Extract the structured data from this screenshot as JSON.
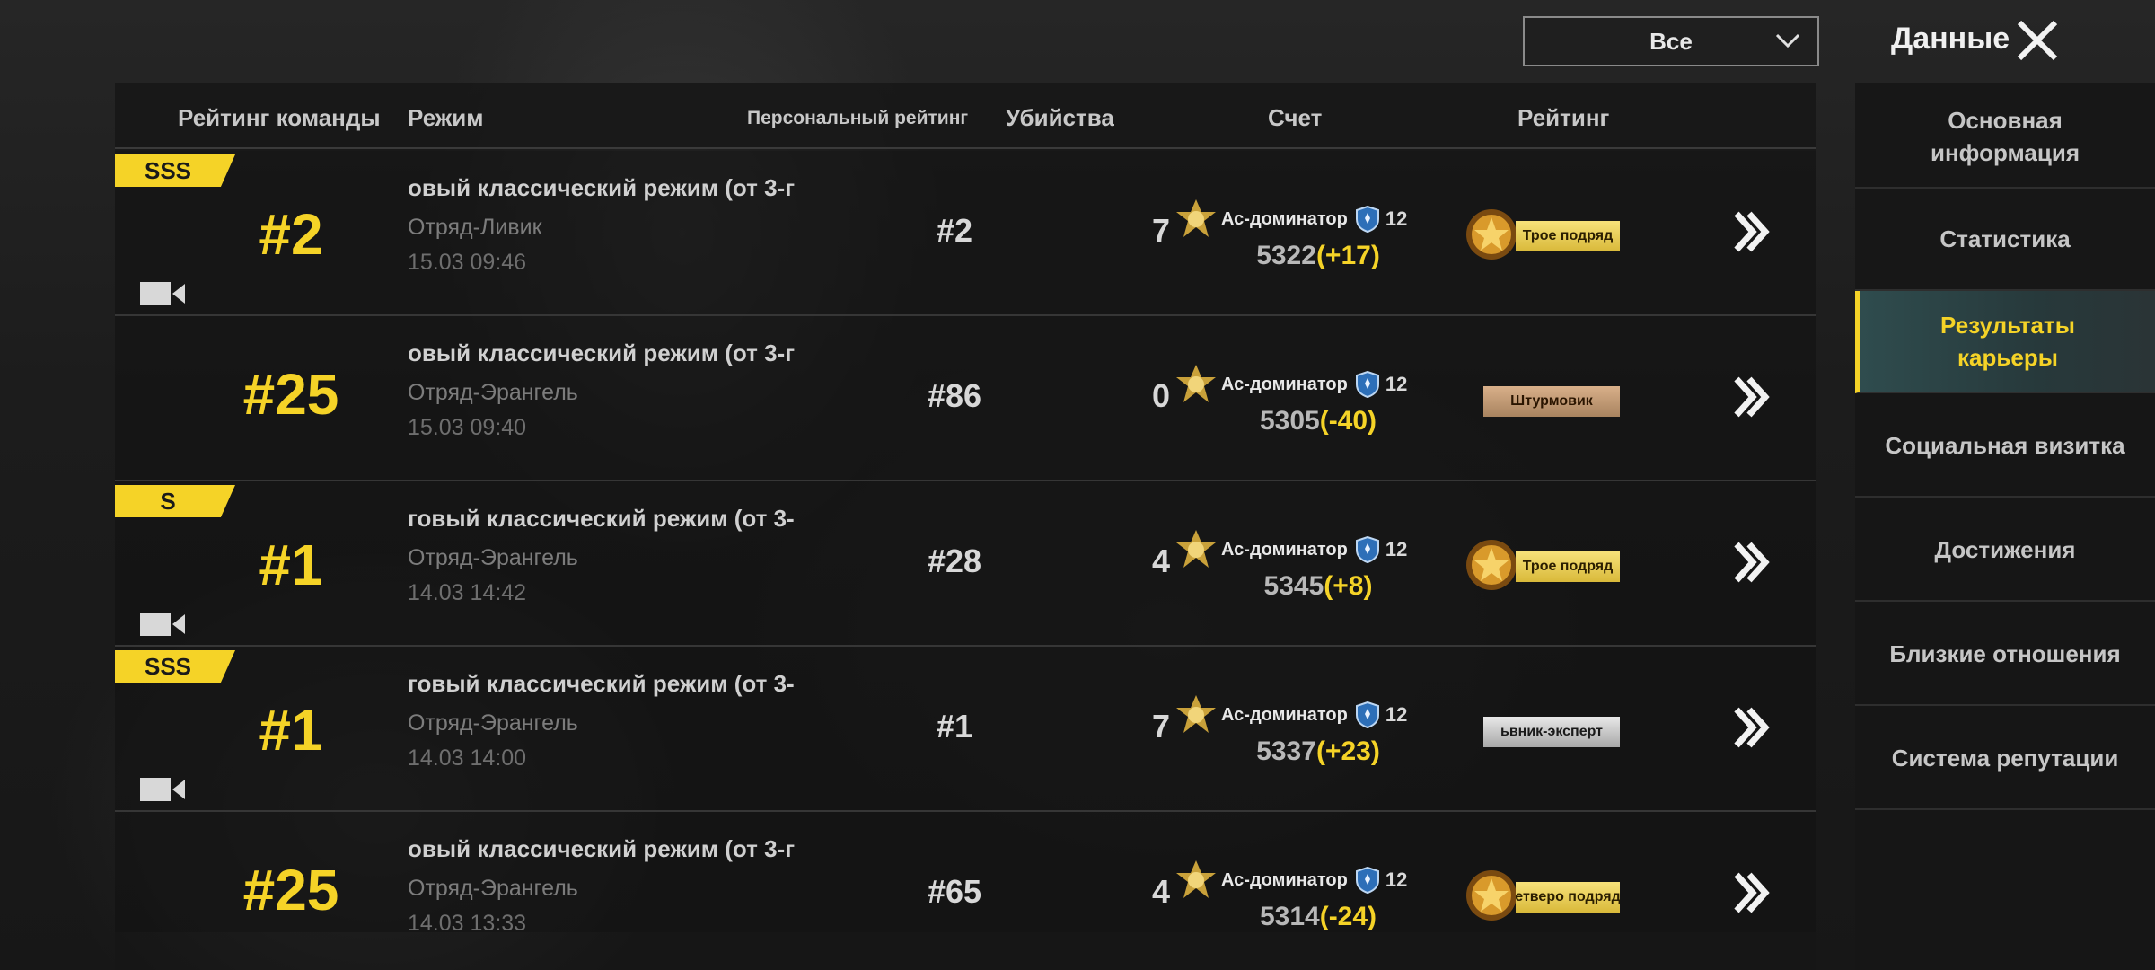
{
  "header": {
    "filter_value": "Все",
    "title": "Данные"
  },
  "columns": {
    "team_rank": "Рейтинг команды",
    "mode": "Режим",
    "personal_rank": "Персональный рейтинг",
    "kills": "Убийства",
    "score": "Счет",
    "rating": "Рейтинг"
  },
  "rows": [
    {
      "grade": "SSS",
      "rank": "#2",
      "mode": "овый классический режим (от 3-г",
      "map": "Отряд-Ливик",
      "time": "15.03 09:46",
      "personal_rank": "#2",
      "kills": "7",
      "tier": "Ас-доминатор",
      "level": "12",
      "score": "5322",
      "delta": "(+17)",
      "achievement": "Трое подряд"
    },
    {
      "grade": "",
      "rank": "#25",
      "mode": "овый классический режим (от 3-г",
      "map": "Отряд-Эрангель",
      "time": "15.03 09:40",
      "personal_rank": "#86",
      "kills": "0",
      "tier": "Ас-доминатор",
      "level": "12",
      "score": "5305",
      "delta": "(-40)",
      "achievement": "Штурмовик"
    },
    {
      "grade": "S",
      "rank": "#1",
      "mode": "говый классический режим (от 3-",
      "map": "Отряд-Эрангель",
      "time": "14.03 14:42",
      "personal_rank": "#28",
      "kills": "4",
      "tier": "Ас-доминатор",
      "level": "12",
      "score": "5345",
      "delta": "(+8)",
      "achievement": "Трое подряд"
    },
    {
      "grade": "SSS",
      "rank": "#1",
      "mode": "говый классический режим (от 3-",
      "map": "Отряд-Эрангель",
      "time": "14.03 14:00",
      "personal_rank": "#1",
      "kills": "7",
      "tier": "Ас-доминатор",
      "level": "12",
      "score": "5337",
      "delta": "(+23)",
      "achievement": "ьвник-эксперт"
    },
    {
      "grade": "",
      "rank": "#25",
      "mode": "овый классический режим (от 3-г",
      "map": "Отряд-Эрангель",
      "time": "14.03 13:33",
      "personal_rank": "#65",
      "kills": "4",
      "tier": "Ас-доминатор",
      "level": "12",
      "score": "5314",
      "delta": "(-24)",
      "achievement": "етверо подряд"
    }
  ],
  "sidebar": {
    "items": [
      {
        "label": "Основная информация"
      },
      {
        "label": "Статистика"
      },
      {
        "label": "Результаты карьеры"
      },
      {
        "label": "Социальная визитка"
      },
      {
        "label": "Достижения"
      },
      {
        "label": "Близкие отношения"
      },
      {
        "label": "Система репутации"
      }
    ]
  },
  "colors": {
    "accent": "#f5d327",
    "active_tab_bg": "#2f4c4e"
  }
}
